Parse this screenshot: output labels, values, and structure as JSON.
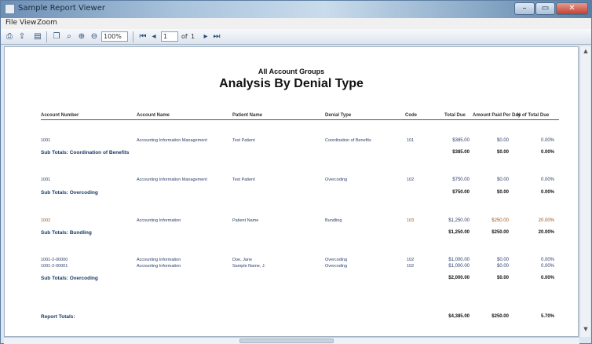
{
  "window": {
    "title": "Sample Report Viewer"
  },
  "menu": [
    {
      "label": "File"
    },
    {
      "label": "View"
    },
    {
      "label": "Zoom"
    }
  ],
  "toolbar": {
    "zoom": "100%",
    "page": "1",
    "of_label": "of",
    "total_pages": "1"
  },
  "report": {
    "subtitle": "All Account Groups",
    "title": "Analysis By Denial Type",
    "columns": [
      "Account Number",
      "Account Name",
      "Patient Name",
      "Denial Type",
      "Code",
      "Total Due",
      "Amount Paid Per Day",
      "% of Total Due"
    ],
    "groups": [
      {
        "rows": [
          {
            "account": "1001",
            "account_name": "Accounting Information Management",
            "patient": "Test Patient",
            "denial": "Coordination of Benefits",
            "code": "101",
            "total": "$385.00",
            "paid": "$0.00",
            "pct": "0.00%"
          }
        ],
        "subtotal_label": "Sub Totals: Coordination of Benefits",
        "subtotal": {
          "total": "$385.00",
          "paid": "$0.00",
          "pct": "0.00%"
        }
      },
      {
        "rows": [
          {
            "account": "1001",
            "account_name": "Accounting Information Management",
            "patient": "Test Patient",
            "denial": "Overcoding",
            "code": "102",
            "total": "$750.00",
            "paid": "$0.00",
            "pct": "0.00%"
          }
        ],
        "subtotal_label": "Sub Totals: Overcoding",
        "subtotal": {
          "total": "$750.00",
          "paid": "$0.00",
          "pct": "0.00%"
        }
      },
      {
        "rows": [
          {
            "account": "1002",
            "account_name": "Accounting Information",
            "patient": "Patient Name",
            "denial": "Bundling",
            "code": "103",
            "total": "$1,250.00",
            "paid": "$250.00",
            "pct": "20.00%",
            "highlight": true
          }
        ],
        "subtotal_label": "Sub Totals: Bundling",
        "subtotal": {
          "total": "$1,250.00",
          "paid": "$250.00",
          "pct": "20.00%"
        }
      },
      {
        "rows": [
          {
            "account": "1001-2-00000",
            "account_name": "Accounting Information",
            "patient": "Doe, Jane",
            "denial": "Overcoding",
            "code": "102",
            "total": "$1,000.00",
            "paid": "$0.00",
            "pct": "0.00%"
          },
          {
            "account": "1001-2-00001",
            "account_name": "Accounting Information",
            "patient": "Sample Name, J.",
            "denial": "Overcoding",
            "code": "102",
            "total": "$1,000.00",
            "paid": "$0.00",
            "pct": "0.00%"
          }
        ],
        "subtotal_label": "Sub Totals: Overcoding",
        "subtotal": {
          "total": "$2,000.00",
          "paid": "$0.00",
          "pct": "0.00%"
        }
      }
    ],
    "grand_total_label": "Report Totals:",
    "grand_total": {
      "total": "$4,385.00",
      "paid": "$250.00",
      "pct": "5.70%"
    }
  }
}
